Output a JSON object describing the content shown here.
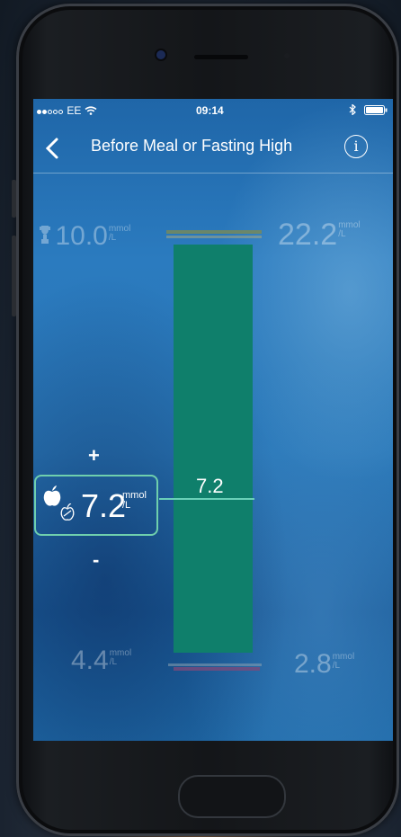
{
  "status_bar": {
    "carrier": "EE",
    "time": "09:14"
  },
  "nav": {
    "title": "Before Meal or Fasting High"
  },
  "scale": {
    "top_left": {
      "value": "10.0",
      "unit_top": "mmol",
      "unit_bottom": "/L"
    },
    "top_right": {
      "value": "22.2",
      "unit_top": "mmol",
      "unit_bottom": "/L"
    },
    "bottom_left": {
      "value": "4.4",
      "unit_top": "mmol",
      "unit_bottom": "/L"
    },
    "bottom_right": {
      "value": "2.8",
      "unit_top": "mmol",
      "unit_bottom": "/L"
    }
  },
  "current": {
    "bar_label": "7.2",
    "value": "7.2",
    "unit_top": "mmol",
    "unit_bottom": "/L"
  },
  "controls": {
    "increase_label": "+",
    "decrease_label": "-"
  },
  "colors": {
    "bar": "#0f7f6b",
    "selection_border": "#6fcfad",
    "background": "#2b7bbf"
  },
  "icons": [
    "signal-dots-icon",
    "wifi-icon",
    "bluetooth-icon",
    "battery-icon",
    "back-chevron-icon",
    "info-icon",
    "trophy-icon",
    "apple-icon",
    "apple-outline-icon"
  ]
}
